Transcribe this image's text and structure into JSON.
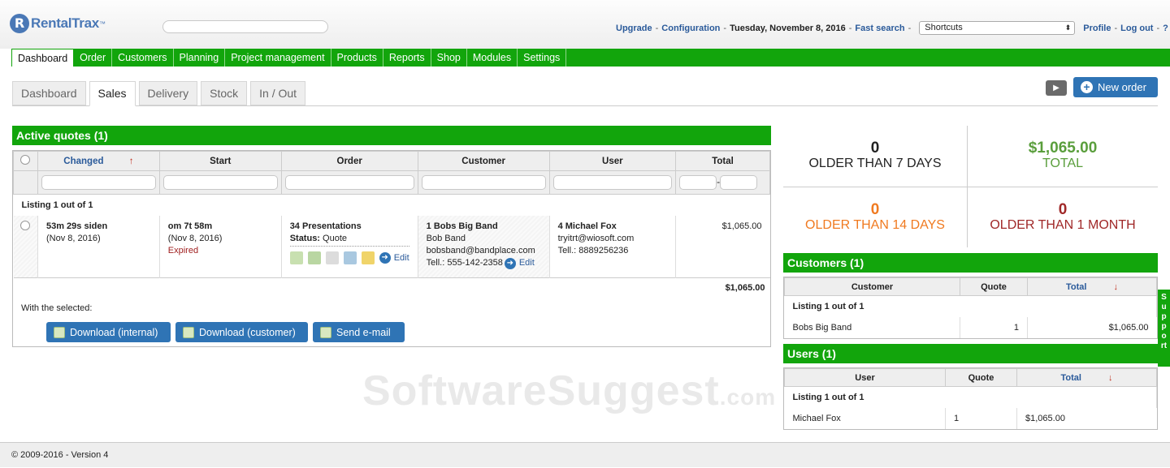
{
  "app": {
    "logo": "RentalTrax",
    "logo_tm": "™"
  },
  "topbar": {
    "upgrade": "Upgrade",
    "configuration": "Configuration",
    "date": "Tuesday, November 8, 2016",
    "fast_search": "Fast search",
    "shortcuts": "Shortcuts",
    "profile": "Profile",
    "logout": "Log out",
    "help": "?"
  },
  "nav": [
    "Dashboard",
    "Order",
    "Customers",
    "Planning",
    "Project management",
    "Products",
    "Reports",
    "Shop",
    "Modules",
    "Settings"
  ],
  "subtabs": [
    "Dashboard",
    "Sales",
    "Delivery",
    "Stock",
    "In / Out"
  ],
  "new_order": "New order",
  "active_quotes": {
    "title": "Active quotes (1)",
    "columns": [
      "Changed",
      "Start",
      "Order",
      "Customer",
      "User",
      "Total"
    ],
    "listing": "Listing 1 out of 1",
    "row": {
      "changed": "53m 29s siden",
      "changed_date": "(Nov 8, 2016)",
      "start": "om 7t 58m",
      "start_date": "(Nov 8, 2016)",
      "start_status": "Expired",
      "order": "34 Presentations",
      "status_label": "Status:",
      "status_value": "Quote",
      "edit": "Edit",
      "customer": "1 Bobs Big Band",
      "contact": "Bob Band",
      "email": "bobsband@bandplace.com",
      "phone": "Tell.: 555-142-2358",
      "user": "4 Michael Fox",
      "user_email": "tryitrt@wiosoft.com",
      "user_phone": "Tell.: 8889256236",
      "total": "$1,065.00"
    },
    "sum": "$1,065.00",
    "with_selected": "With the selected:",
    "buttons": [
      "Download (internal)",
      "Download (customer)",
      "Send e-mail"
    ],
    "range_sep": "-"
  },
  "stats": [
    {
      "value": "0",
      "label": "OLDER THAN 7 DAYS",
      "color": "#111111"
    },
    {
      "value": "$1,065.00",
      "label": "TOTAL",
      "color": "#5a9e3c"
    },
    {
      "value": "0",
      "label": "OLDER THAN 14 DAYS",
      "color": "#f07a20"
    },
    {
      "value": "0",
      "label": "OLDER THAN 1 MONTH",
      "color": "#a02828"
    }
  ],
  "customers_box": {
    "title": "Customers (1)",
    "columns": [
      "Customer",
      "Quote",
      "Total"
    ],
    "listing": "Listing 1 out of 1",
    "row": {
      "name": "Bobs Big Band",
      "quote": "1",
      "total": "$1,065.00"
    }
  },
  "users_box": {
    "title": "Users (1)",
    "columns": [
      "User",
      "Quote",
      "Total"
    ],
    "listing": "Listing 1 out of 1",
    "row": {
      "name": "Michael Fox",
      "quote": "1",
      "total": "$1,065.00"
    }
  },
  "support": "Support",
  "footer": "© 2009-2016 - Version 4",
  "watermark": {
    "main": "SoftwareSuggest",
    "suffix": ".com"
  },
  "colors": {
    "green": "#12a50c",
    "blue": "#2f74b5",
    "link": "#2a5a9a"
  }
}
